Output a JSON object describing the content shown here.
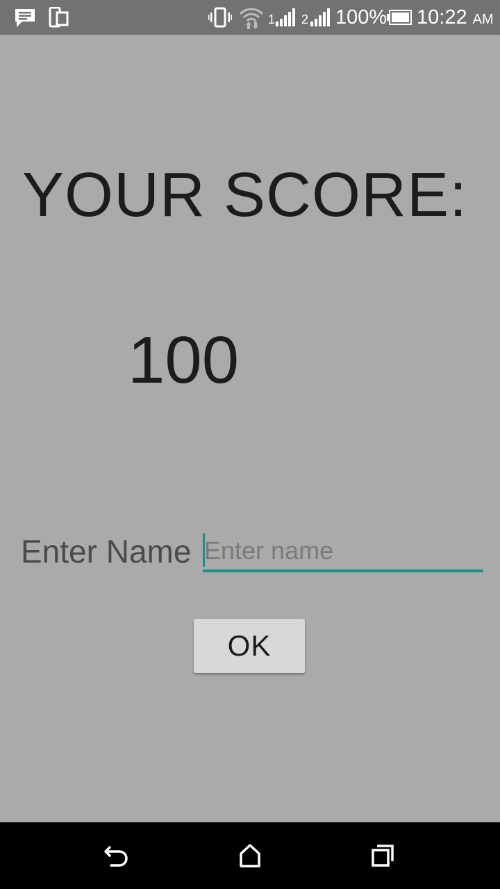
{
  "status_bar": {
    "battery_percent": "100%",
    "time": "10:22",
    "ampm": "AM",
    "sim1": "1",
    "sim2": "2",
    "icons": [
      "message-icon",
      "device-icon",
      "vibrate-icon",
      "wifi-icon",
      "signal-sim1-icon",
      "signal-sim2-icon",
      "battery-icon"
    ]
  },
  "main": {
    "score_title": "YOUR SCORE:",
    "score_value": "100",
    "name_label": "Enter Name",
    "name_input": {
      "value": "",
      "placeholder": "Enter name"
    },
    "ok_button_label": "OK"
  },
  "nav_bar": {
    "icons": [
      "back-icon",
      "home-icon",
      "recents-icon"
    ]
  },
  "colors": {
    "background": "#aaaaaa",
    "status_bar": "#727272",
    "accent": "#17928a",
    "button_bg": "#d8d8d8",
    "nav_bar": "#000000"
  }
}
